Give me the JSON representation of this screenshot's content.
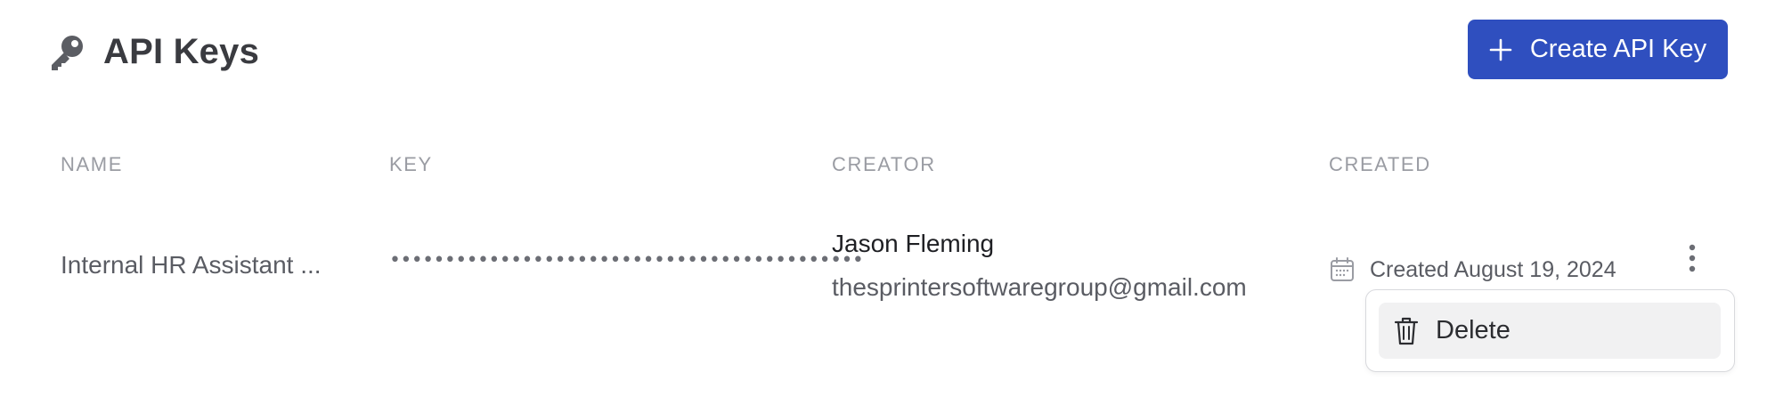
{
  "header": {
    "title": "API Keys",
    "title_icon": "key-icon",
    "create_button": {
      "label": "Create API Key",
      "icon": "plus-icon",
      "color": "#2f4fbf"
    }
  },
  "table": {
    "columns": [
      "NAME",
      "KEY",
      "CREATOR",
      "CREATED"
    ],
    "rows": [
      {
        "name": "Internal HR Assistant ...",
        "key": "•••••••••••••••••••••••••••••••••••••••••••",
        "creator_name": "Jason Fleming",
        "creator_email": "thesprintersoftwaregroup@gmail.com",
        "created_icon": "calendar-icon",
        "created": "Created August 19, 2024",
        "actions_icon": "more-vertical-icon"
      }
    ]
  },
  "dropdown_menu": {
    "items": [
      {
        "label": "Delete",
        "icon": "trash-icon"
      }
    ]
  }
}
